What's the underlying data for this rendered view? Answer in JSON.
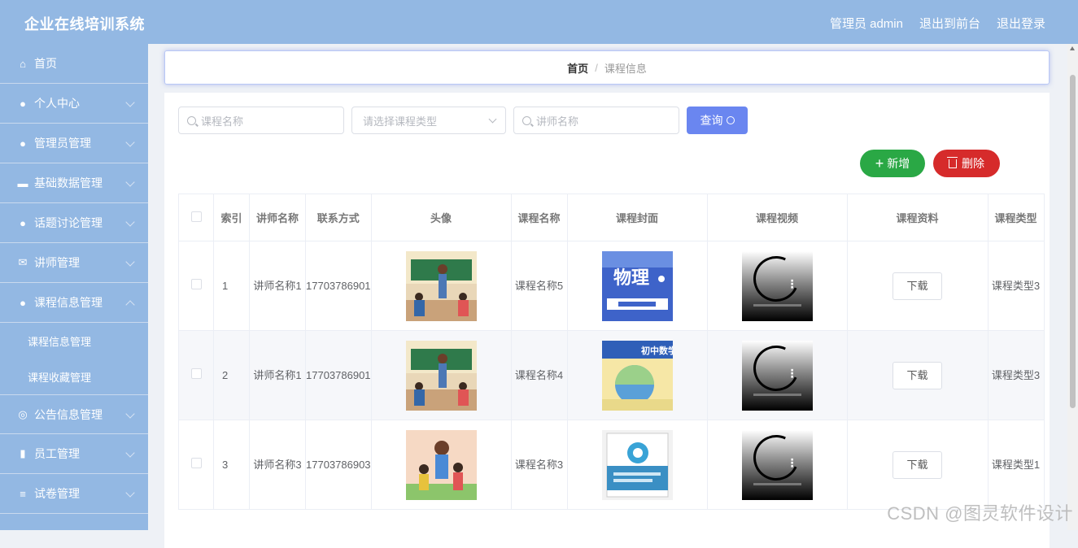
{
  "header": {
    "brand": "企业在线培训系统",
    "admin_label": "管理员 admin",
    "back_front": "退出到前台",
    "logout": "退出登录"
  },
  "sidebar": {
    "items": [
      {
        "label": "首页",
        "icon": "home-icon"
      },
      {
        "label": "个人中心",
        "icon": "user-icon"
      },
      {
        "label": "管理员管理",
        "icon": "admin-icon"
      },
      {
        "label": "基础数据管理",
        "icon": "database-icon"
      },
      {
        "label": "话题讨论管理",
        "icon": "bulb-icon"
      },
      {
        "label": "讲师管理",
        "icon": "mail-icon"
      },
      {
        "label": "课程信息管理",
        "icon": "user-icon"
      }
    ],
    "sub_items": [
      "课程信息管理",
      "课程收藏管理"
    ],
    "items_after": [
      {
        "label": "公告信息管理",
        "icon": "compass-icon"
      },
      {
        "label": "员工管理",
        "icon": "bar-chart-icon"
      },
      {
        "label": "试卷管理",
        "icon": "list-icon"
      }
    ]
  },
  "breadcrumb": {
    "home": "首页",
    "separator": "/",
    "current": "课程信息"
  },
  "filters": {
    "course_name_placeholder": "课程名称",
    "course_type_placeholder": "请选择课程类型",
    "teacher_name_placeholder": "讲师名称",
    "query_label": "查询"
  },
  "actions": {
    "add_label": "新增",
    "delete_label": "删除"
  },
  "table": {
    "headers": [
      "索引",
      "讲师名称",
      "联系方式",
      "头像",
      "课程名称",
      "课程封面",
      "课程视频",
      "课程资料",
      "课程类型"
    ],
    "rows": [
      {
        "index": "1",
        "teacher": "讲师名称1",
        "phone": "17703786901",
        "course": "课程名称5",
        "download": "下载",
        "type": "课程类型3",
        "cover_title": "物理"
      },
      {
        "index": "2",
        "teacher": "讲师名称1",
        "phone": "17703786901",
        "course": "课程名称4",
        "download": "下载",
        "type": "课程类型3",
        "cover_title": "初中数学"
      },
      {
        "index": "3",
        "teacher": "讲师名称3",
        "phone": "17703786903",
        "course": "课程名称3",
        "download": "下载",
        "type": "课程类型1",
        "cover_title": ""
      }
    ]
  },
  "watermark": "CSDN @图灵软件设计"
}
